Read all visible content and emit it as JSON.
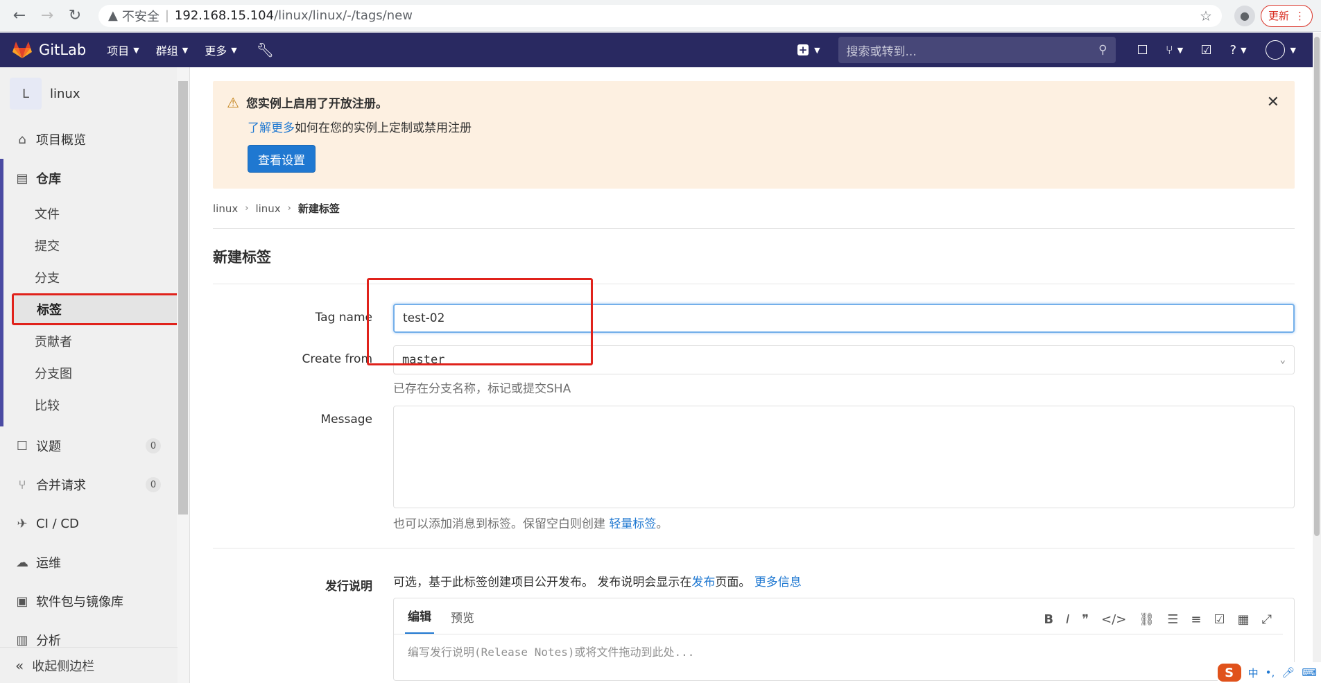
{
  "browser": {
    "insecure_label": "不安全",
    "url_host": "192.168.15.104",
    "url_path": "/linux/linux/-/tags/new",
    "update_label": "更新"
  },
  "topnav": {
    "brand": "GitLab",
    "menus": [
      "项目",
      "群组",
      "更多"
    ],
    "search_placeholder": "搜索或转到..."
  },
  "sidebar": {
    "project_initial": "L",
    "project_name": "linux",
    "overview": "项目概览",
    "repo": "仓库",
    "repo_items": [
      "文件",
      "提交",
      "分支",
      "标签",
      "贡献者",
      "分支图",
      "比较"
    ],
    "issues": "议题",
    "issues_count": "0",
    "merge_requests": "合并请求",
    "mr_count": "0",
    "cicd": "CI / CD",
    "ops": "运维",
    "packages": "软件包与镜像库",
    "analytics": "分析",
    "collapse": "收起侧边栏"
  },
  "alert": {
    "title": "您实例上启用了开放注册。",
    "link": "了解更多",
    "body": "如何在您的实例上定制或禁用注册",
    "button": "查看设置"
  },
  "breadcrumb": [
    "linux",
    "linux",
    "新建标签"
  ],
  "page_title": "新建标签",
  "form": {
    "tag_name_label": "Tag name",
    "tag_name_value": "test-02",
    "create_from_label": "Create from",
    "create_from_value": "master",
    "create_from_help": "已存在分支名称，标记或提交SHA",
    "message_label": "Message",
    "message_help_prefix": "也可以添加消息到标签。保留空白则创建 ",
    "message_help_link": "轻量标签",
    "message_help_suffix": "。",
    "release_label": "发行说明",
    "release_help_prefix": "可选，基于此标签创建项目公开发布。 发布说明会显示在",
    "release_help_link1": "发布",
    "release_help_mid": "页面。 ",
    "release_help_link2": "更多信息",
    "editor_tab_write": "编辑",
    "editor_tab_preview": "预览",
    "editor_placeholder": "编写发行说明(Release Notes)或将文件拖动到此处..."
  },
  "ime": {
    "chinese": "中",
    "punct": "•,"
  },
  "colors": {
    "nav": "#292961",
    "accent": "#1f78d1",
    "highlight": "#e0221b"
  }
}
